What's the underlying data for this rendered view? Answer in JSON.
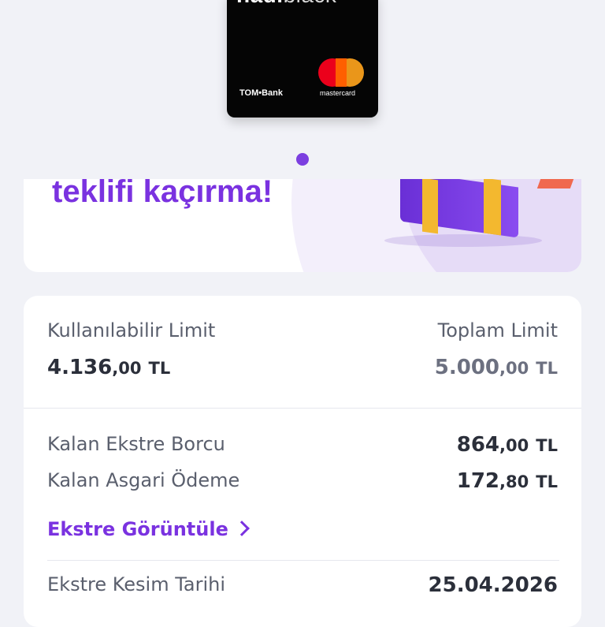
{
  "card": {
    "brand_bold": "nadi",
    "brand_light": "black",
    "bank": "TOM•Bank",
    "network": "mastercard"
  },
  "banner": {
    "text": "teklifi kaçırma!"
  },
  "limits": {
    "available_label": "Kullanılabilir Limit",
    "available_int": "4.136",
    "available_dec": ",00",
    "available_cur": "TL",
    "total_label": "Toplam Limit",
    "total_int": "5.000",
    "total_dec": ",00",
    "total_cur": "TL"
  },
  "statement": {
    "remaining_debt_label": "Kalan Ekstre Borcu",
    "remaining_debt_int": "864",
    "remaining_debt_dec": ",00",
    "remaining_debt_cur": "TL",
    "min_payment_label": "Kalan Asgari Ödeme",
    "min_payment_int": "172",
    "min_payment_dec": ",80",
    "min_payment_cur": "TL",
    "view_link": "Ekstre Görüntüle",
    "cut_date_label": "Ekstre Kesim Tarihi",
    "cut_date": "25.04.2026"
  },
  "colors": {
    "accent": "#7a32e0",
    "background": "#f1f2f7"
  }
}
